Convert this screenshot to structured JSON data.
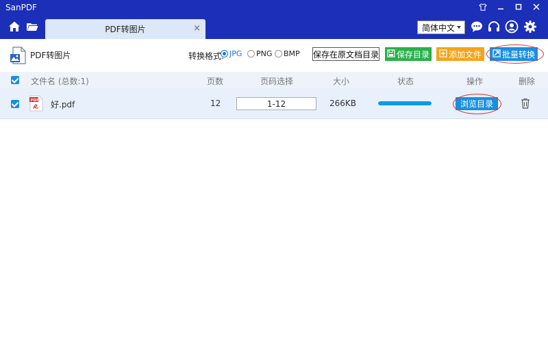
{
  "window": {
    "title": "SanPDF",
    "controls": [
      "skin-icon",
      "minimize-icon",
      "maximize-icon",
      "close-icon"
    ]
  },
  "nav": {
    "tab_label": "PDF转图片",
    "tab_close": "×",
    "language": "简体中文"
  },
  "toolbar": {
    "title": "PDF转图片",
    "format_label": "转换格式:",
    "formats": [
      {
        "label": "JPG",
        "selected": true
      },
      {
        "label": "PNG",
        "selected": false
      },
      {
        "label": "BMP",
        "selected": false
      }
    ],
    "save_original_label": "保存在原文档目录",
    "save_dir_label": "保存目录",
    "add_file_label": "添加文件",
    "batch_convert_label": "批量转换"
  },
  "table": {
    "headers": {
      "filename": "文件名 (总数:1)",
      "pages": "页数",
      "page_range": "页码选择",
      "size": "大小",
      "status": "状态",
      "action": "操作",
      "delete": "删除"
    },
    "rows": [
      {
        "filename": "好.pdf",
        "pages": "12",
        "page_range": "1-12",
        "size": "266KB",
        "progress": 1.0,
        "action_label": "浏览目录"
      }
    ]
  },
  "colors": {
    "titlebar": "#1b2fb8",
    "accent": "#1a8fe0",
    "green": "#28b04a",
    "orange": "#f4a41b",
    "progress": "#0b9be6",
    "annotation": "#d33333"
  }
}
